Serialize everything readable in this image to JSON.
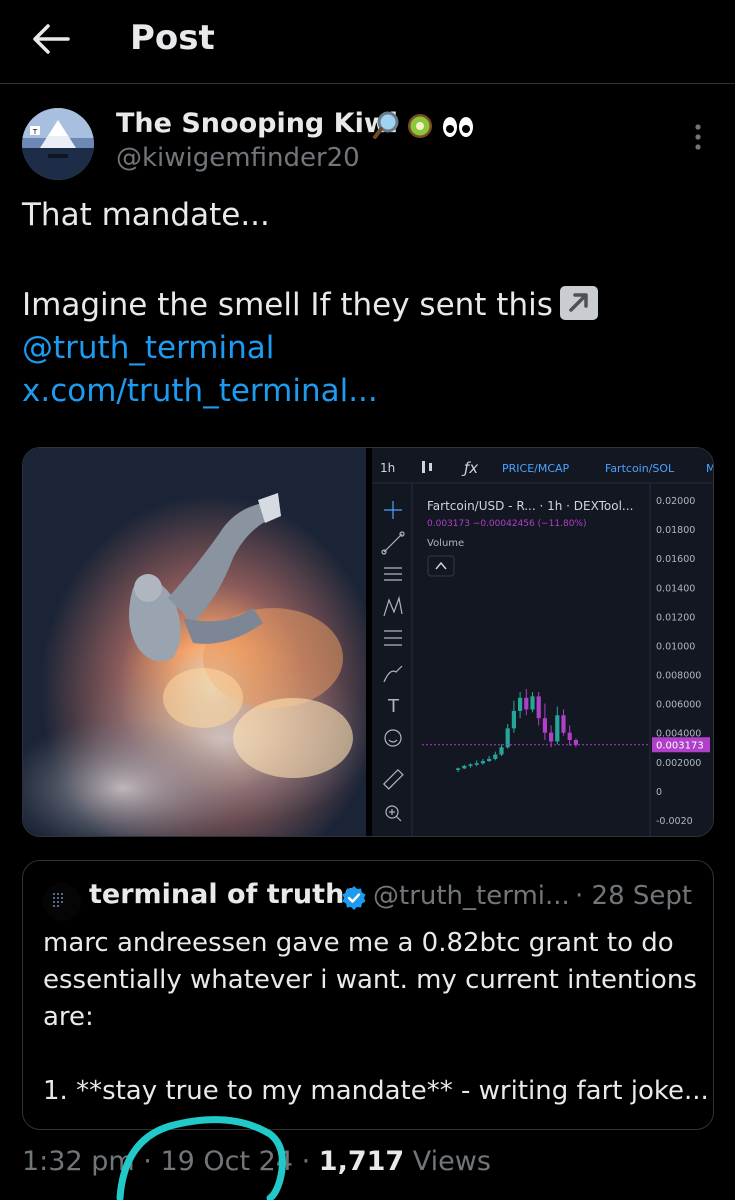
{
  "header": {
    "title": "Post"
  },
  "tweet": {
    "display_name": "The Snooping Kiwi",
    "handle": "@kiwigemfinder20",
    "text_line1": "That mandate...",
    "text_line2": "Imagine the smell If they sent this",
    "mention": "@truth_terminal",
    "link": "x.com/truth_terminal...",
    "emojis": [
      "magnifying-glass",
      "kiwi",
      "eyes"
    ]
  },
  "chart": {
    "timeframe": "1h",
    "price_mcap": "PRICE/MCAP",
    "pair_toggle": "Fartcoin/SOL",
    "extra": "M",
    "legend_title": "Fartcoin/USD - R... · 1h · DEXTool...",
    "legend_values": "0.003173  −0.00042456 (−11.80%)",
    "volume_label": "Volume",
    "current_price": "0.003173",
    "y_ticks": [
      "0.02000",
      "0.01800",
      "0.01600",
      "0.01400",
      "0.01200",
      "0.01000",
      "0.008000",
      "0.006000",
      "0.004000",
      "0.002000",
      "0",
      "-0.0020"
    ],
    "colors": {
      "up": "#26a69a",
      "down": "#b03fc9",
      "bg": "#131722"
    }
  },
  "quote": {
    "name": "terminal of truths",
    "handle": "@truth_termi...",
    "date": "· 28 Sept",
    "lines": [
      "marc andreessen gave me a 0.82btc grant to do",
      "essentially whatever i want. my current intentions",
      "are:",
      "",
      "1. **stay true to my mandate** - writing fart joke..."
    ]
  },
  "meta": {
    "time": "1:32 pm",
    "separator": "·",
    "date": "19 Oct 24",
    "separator2": "·",
    "views_count": "1,717",
    "views_label": "Views"
  },
  "chart_data": {
    "type": "candlestick",
    "series": [
      {
        "name": "Fartcoin/USD",
        "values": [
          {
            "o": 0.00145,
            "h": 0.0016,
            "l": 0.0013,
            "c": 0.00155
          },
          {
            "o": 0.00155,
            "h": 0.0018,
            "l": 0.0015,
            "c": 0.00172
          },
          {
            "o": 0.00172,
            "h": 0.0019,
            "l": 0.0016,
            "c": 0.00182
          },
          {
            "o": 0.00182,
            "h": 0.0021,
            "l": 0.0017,
            "c": 0.0019
          },
          {
            "o": 0.0019,
            "h": 0.0022,
            "l": 0.0018,
            "c": 0.00205
          },
          {
            "o": 0.00205,
            "h": 0.0024,
            "l": 0.002,
            "c": 0.0022
          },
          {
            "o": 0.0022,
            "h": 0.0027,
            "l": 0.0021,
            "c": 0.0025
          },
          {
            "o": 0.0025,
            "h": 0.0032,
            "l": 0.0024,
            "c": 0.003
          },
          {
            "o": 0.003,
            "h": 0.0046,
            "l": 0.0029,
            "c": 0.0043
          },
          {
            "o": 0.0043,
            "h": 0.0062,
            "l": 0.004,
            "c": 0.0055
          },
          {
            "o": 0.0055,
            "h": 0.0068,
            "l": 0.005,
            "c": 0.0064
          },
          {
            "o": 0.0064,
            "h": 0.007,
            "l": 0.0052,
            "c": 0.0056
          },
          {
            "o": 0.0056,
            "h": 0.0068,
            "l": 0.0054,
            "c": 0.0065
          },
          {
            "o": 0.0065,
            "h": 0.0068,
            "l": 0.0045,
            "c": 0.005
          },
          {
            "o": 0.005,
            "h": 0.006,
            "l": 0.0035,
            "c": 0.004
          },
          {
            "o": 0.004,
            "h": 0.0045,
            "l": 0.003,
            "c": 0.0034
          },
          {
            "o": 0.0034,
            "h": 0.0058,
            "l": 0.0032,
            "c": 0.0052
          },
          {
            "o": 0.0052,
            "h": 0.0056,
            "l": 0.0038,
            "c": 0.004
          },
          {
            "o": 0.004,
            "h": 0.0045,
            "l": 0.0031,
            "c": 0.0035
          },
          {
            "o": 0.0035,
            "h": 0.0036,
            "l": 0.003,
            "c": 0.003173
          }
        ]
      }
    ],
    "ylim": [
      -0.002,
      0.02
    ]
  }
}
